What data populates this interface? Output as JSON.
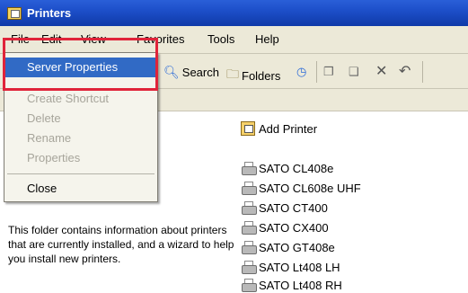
{
  "window": {
    "title": "Printers"
  },
  "menubar": {
    "items": [
      {
        "label": "File"
      },
      {
        "label": "Edit"
      },
      {
        "label": "View"
      },
      {
        "label": "Favorites"
      },
      {
        "label": "Tools"
      },
      {
        "label": "Help"
      }
    ]
  },
  "toolbar": {
    "search_label": "Search",
    "folders_label": "Folders"
  },
  "file_menu": {
    "items": [
      {
        "label": "Server Properties",
        "state": "selected"
      },
      {
        "label": "Create Shortcut",
        "state": "disabled"
      },
      {
        "label": "Delete",
        "state": "disabled"
      },
      {
        "label": "Rename",
        "state": "disabled"
      },
      {
        "label": "Properties",
        "state": "disabled"
      },
      {
        "label": "Close",
        "state": "enabled"
      }
    ]
  },
  "left_pane": {
    "info_text": "This folder contains information about printers that are currently installed, and a wizard to help you install new printers."
  },
  "printers": {
    "add_printer_label": "Add Printer",
    "items": [
      {
        "name": "SATO CL408e"
      },
      {
        "name": "SATO CL608e UHF"
      },
      {
        "name": "SATO CT400"
      },
      {
        "name": "SATO CX400"
      },
      {
        "name": "SATO GT408e"
      },
      {
        "name": "SATO Lt408 LH"
      },
      {
        "name": "SATO Lt408 RH"
      }
    ]
  },
  "colors": {
    "title_bar": "#1d4fc9",
    "menu_bg": "#ece9d8",
    "selection": "#316ac5",
    "highlight_box": "#e0243a"
  }
}
